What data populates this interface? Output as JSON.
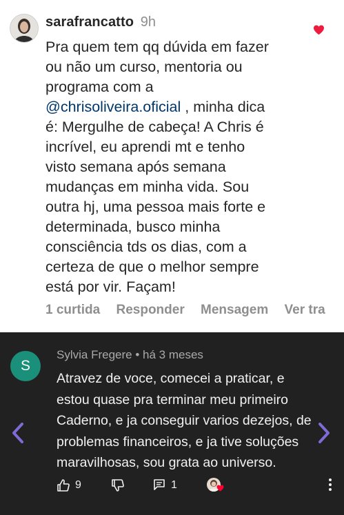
{
  "ig_comment": {
    "username": "sarafrancatto",
    "time": "9h",
    "body_lines": [
      {
        "pre": "Pra quem tem qq dúvida em fazer",
        "mention": "",
        "post": ""
      },
      {
        "pre": "ou não um curso, mentoria ou",
        "mention": "",
        "post": ""
      },
      {
        "pre": "programa com a",
        "mention": "",
        "post": ""
      },
      {
        "pre": "",
        "mention": "@chrisoliveira.oficial",
        "post": " , minha dica"
      },
      {
        "pre": "é: Mergulhe de cabeça! A Chris é",
        "mention": "",
        "post": ""
      },
      {
        "pre": "incrível, eu aprendi mt e tenho",
        "mention": "",
        "post": ""
      },
      {
        "pre": "visto semana após semana",
        "mention": "",
        "post": ""
      },
      {
        "pre": "mudanças em minha vida. Sou",
        "mention": "",
        "post": ""
      },
      {
        "pre": "outra hj, uma pessoa mais forte e",
        "mention": "",
        "post": ""
      },
      {
        "pre": "determinada, busco minha",
        "mention": "",
        "post": ""
      },
      {
        "pre": "consciência tds os dias, com a",
        "mention": "",
        "post": ""
      },
      {
        "pre": "certeza de que o melhor sempre",
        "mention": "",
        "post": ""
      },
      {
        "pre": "está por vir. Façam!",
        "mention": "",
        "post": ""
      }
    ],
    "actions": {
      "likes": "1 curtida",
      "reply": "Responder",
      "message": "Mensagem",
      "see_translation": "Ver tra"
    },
    "like_icon": "heart-icon",
    "heart_color": "#ed1c3f"
  },
  "yt_comment": {
    "avatar_letter": "S",
    "avatar_color": "#1a8f7a",
    "author": "Sylvia Fregere",
    "time": "há 3 meses",
    "body_lines": [
      "Atravez de voce, comecei a praticar, e",
      "estou quase pra terminar meu primeiro",
      "Caderno, e ja conseguir varios dezejos, de",
      "problemas financeiros, e ja tive soluções",
      "maravilhosas, sou grata ao universo."
    ],
    "like_count": "9",
    "reply_count": "1",
    "nav_color": "#7e6bd6"
  }
}
